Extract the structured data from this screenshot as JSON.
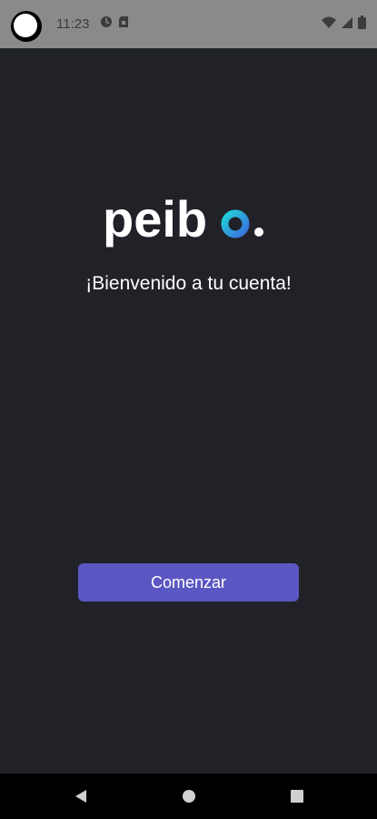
{
  "status_bar": {
    "time": "11:23",
    "icons_left": [
      "vpn-key-icon",
      "sim-card-icon"
    ],
    "icons_right": [
      "wifi-icon",
      "signal-icon",
      "battery-icon"
    ]
  },
  "main": {
    "logo_text": "peibo",
    "welcome_text": "¡Bienvenido a tu cuenta!",
    "start_button_label": "Comenzar"
  },
  "nav_bar": {
    "buttons": [
      "back-icon",
      "home-icon",
      "recents-icon"
    ]
  },
  "colors": {
    "background": "#202228",
    "status_bar": "#8a8a8a",
    "button": "#5b57c2",
    "logo_accent_start": "#1fd1d6",
    "logo_accent_end": "#3b6fe0"
  }
}
